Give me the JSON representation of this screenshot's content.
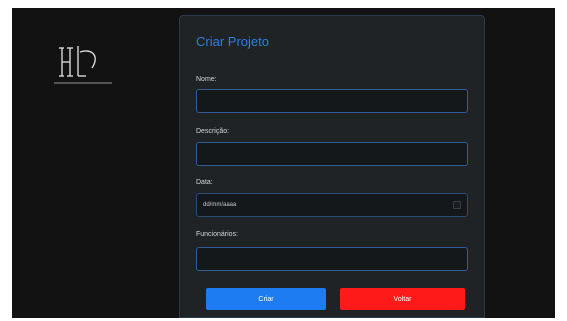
{
  "form": {
    "title": "Criar Projeto",
    "fields": [
      {
        "label": "Nome:",
        "value": "",
        "placeholder": ""
      },
      {
        "label": "Descrição:",
        "value": "",
        "placeholder": ""
      },
      {
        "label": "Data:",
        "value": "dd/mm/aaaa",
        "placeholder": "dd/mm/aaaa"
      },
      {
        "label": "Funcionários:",
        "value": "",
        "placeholder": ""
      }
    ],
    "buttons": {
      "create": "Criar",
      "back": "Voltar"
    }
  },
  "icons": {
    "logo": "hl-monogram-logo",
    "date_picker": "calendar-icon"
  },
  "colors": {
    "accent": "#2f7de1",
    "primary_button": "#1e7cf2",
    "danger_button": "#ff1a1a",
    "background": "#121212",
    "card": "#1f2326"
  }
}
